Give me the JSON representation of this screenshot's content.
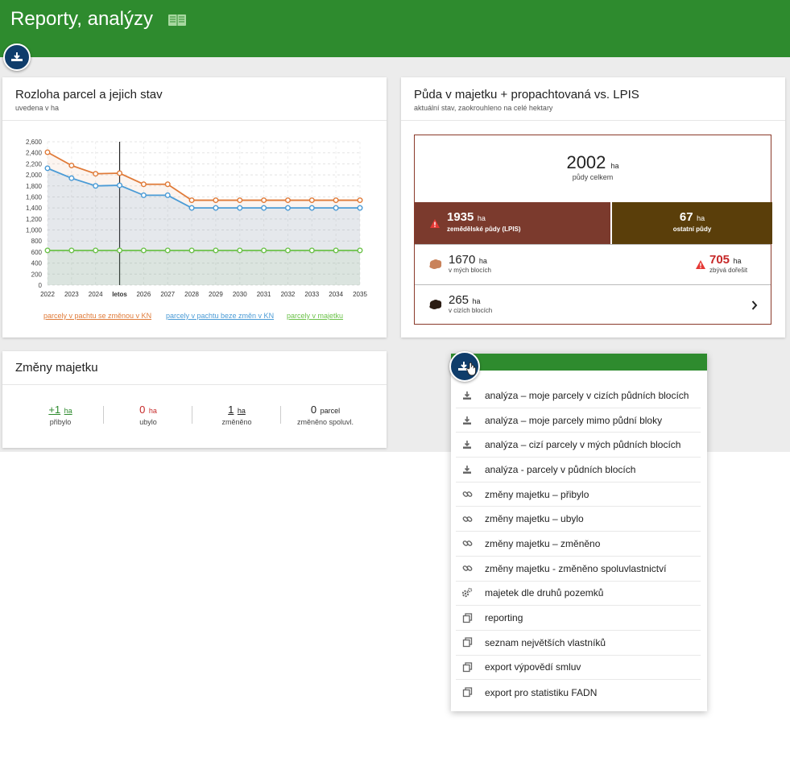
{
  "app": {
    "title": "Reporty, analýzy",
    "book_icon": "book-icon",
    "fab_icon": "download-icon"
  },
  "colors": {
    "green": "#2e8b2e",
    "navy": "#0f3d6b",
    "orange": "#e07b39",
    "blue": "#4a9bd6",
    "lightgreen": "#6cc24a",
    "brown": "#7b3a2d",
    "darkbrown": "#5a3e0a",
    "red": "#c62828"
  },
  "parcels_card": {
    "title": "Rozloha parcel a jejich stav",
    "subtitle": "uvedena v ha",
    "legend": [
      "parcely v pachtu se změnou v KN",
      "parcely v pachtu beze změn v KN",
      "parcely v majetku"
    ]
  },
  "chart_data": {
    "type": "line",
    "x": [
      "2022",
      "2023",
      "2024",
      "letos",
      "2026",
      "2027",
      "2028",
      "2029",
      "2030",
      "2031",
      "2032",
      "2033",
      "2034",
      "2035"
    ],
    "ylim": [
      0,
      2600
    ],
    "yticks": [
      "0",
      "200",
      "400",
      "600",
      "800",
      "1,000",
      "1,200",
      "1,400",
      "1,600",
      "1,800",
      "2,000",
      "2,200",
      "2,400",
      "2,600"
    ],
    "grid": true,
    "legend_position": "bottom",
    "series": [
      {
        "name": "parcely v pachtu se změnou v KN",
        "color": "#e07b39",
        "values": [
          2410,
          2170,
          2020,
          2030,
          1830,
          1830,
          1540,
          1540,
          1540,
          1540,
          1540,
          1540,
          1540,
          1540
        ]
      },
      {
        "name": "parcely v pachtu beze změn v KN",
        "color": "#4a9bd6",
        "values": [
          2120,
          1940,
          1800,
          1810,
          1630,
          1630,
          1400,
          1400,
          1400,
          1400,
          1400,
          1400,
          1400,
          1400
        ]
      },
      {
        "name": "parcely v majetku",
        "color": "#6cc24a",
        "values": [
          630,
          630,
          630,
          630,
          630,
          630,
          630,
          630,
          630,
          630,
          630,
          630,
          630,
          630
        ]
      }
    ]
  },
  "soil_card": {
    "title": "Půda v majetku + propachtovaná vs. LPIS",
    "subtitle": "aktuální stav, zaokrouhleno na celé hektary",
    "total": {
      "value": "2002",
      "unit": "ha",
      "label": "půdy celkem"
    },
    "lpis": {
      "value": "1935",
      "unit": "ha",
      "label": "zemědělské půdy (LPIS)"
    },
    "other": {
      "value": "67",
      "unit": "ha",
      "label": "ostatní půdy"
    },
    "own_blocks": {
      "value": "1670",
      "unit": "ha",
      "label": "v mých blocích"
    },
    "remaining": {
      "value": "705",
      "unit": "ha",
      "label": "zbývá dořešit"
    },
    "foreign_blocks": {
      "value": "265",
      "unit": "ha",
      "label": "v cizích blocích"
    }
  },
  "changes_card": {
    "title": "Změny majetku",
    "stats": [
      {
        "value": "+1",
        "unit": "ha",
        "label": "přibylo",
        "color": "#2e8b2e"
      },
      {
        "value": "0",
        "unit": "ha",
        "label": "ubylo",
        "color": "#c62828"
      },
      {
        "value": "1",
        "unit": "ha",
        "label": "změněno",
        "color": "#222222"
      },
      {
        "value": "0",
        "unit": "parcel",
        "label": "změněno spoluvl.",
        "color": "#222222"
      }
    ]
  },
  "menu": {
    "items": [
      {
        "label": "analýza – moje parcely v cizích půdních blocích",
        "icon": "download-icon"
      },
      {
        "label": "analýza – moje parcely mimo půdní bloky",
        "icon": "download-icon"
      },
      {
        "label": "analýza – cizí parcely v mých půdních blocích",
        "icon": "download-icon"
      },
      {
        "label": "analýza - parcely v půdních blocích",
        "icon": "download-icon"
      },
      {
        "label": "změny majetku – přibylo",
        "icon": "link-icon"
      },
      {
        "label": "změny majetku – ubylo",
        "icon": "link-icon"
      },
      {
        "label": "změny majetku – změněno",
        "icon": "link-icon"
      },
      {
        "label": "změny majetku - změněno spoluvlastnictví",
        "icon": "link-icon"
      },
      {
        "label": "majetek dle druhů pozemků",
        "icon": "gears-icon"
      },
      {
        "label": "reporting",
        "icon": "copy-icon"
      },
      {
        "label": "seznam největších vlastníků",
        "icon": "copy-icon"
      },
      {
        "label": "export výpovědí smluv",
        "icon": "copy-icon"
      },
      {
        "label": "export pro statistiku FADN",
        "icon": "copy-icon"
      }
    ]
  }
}
